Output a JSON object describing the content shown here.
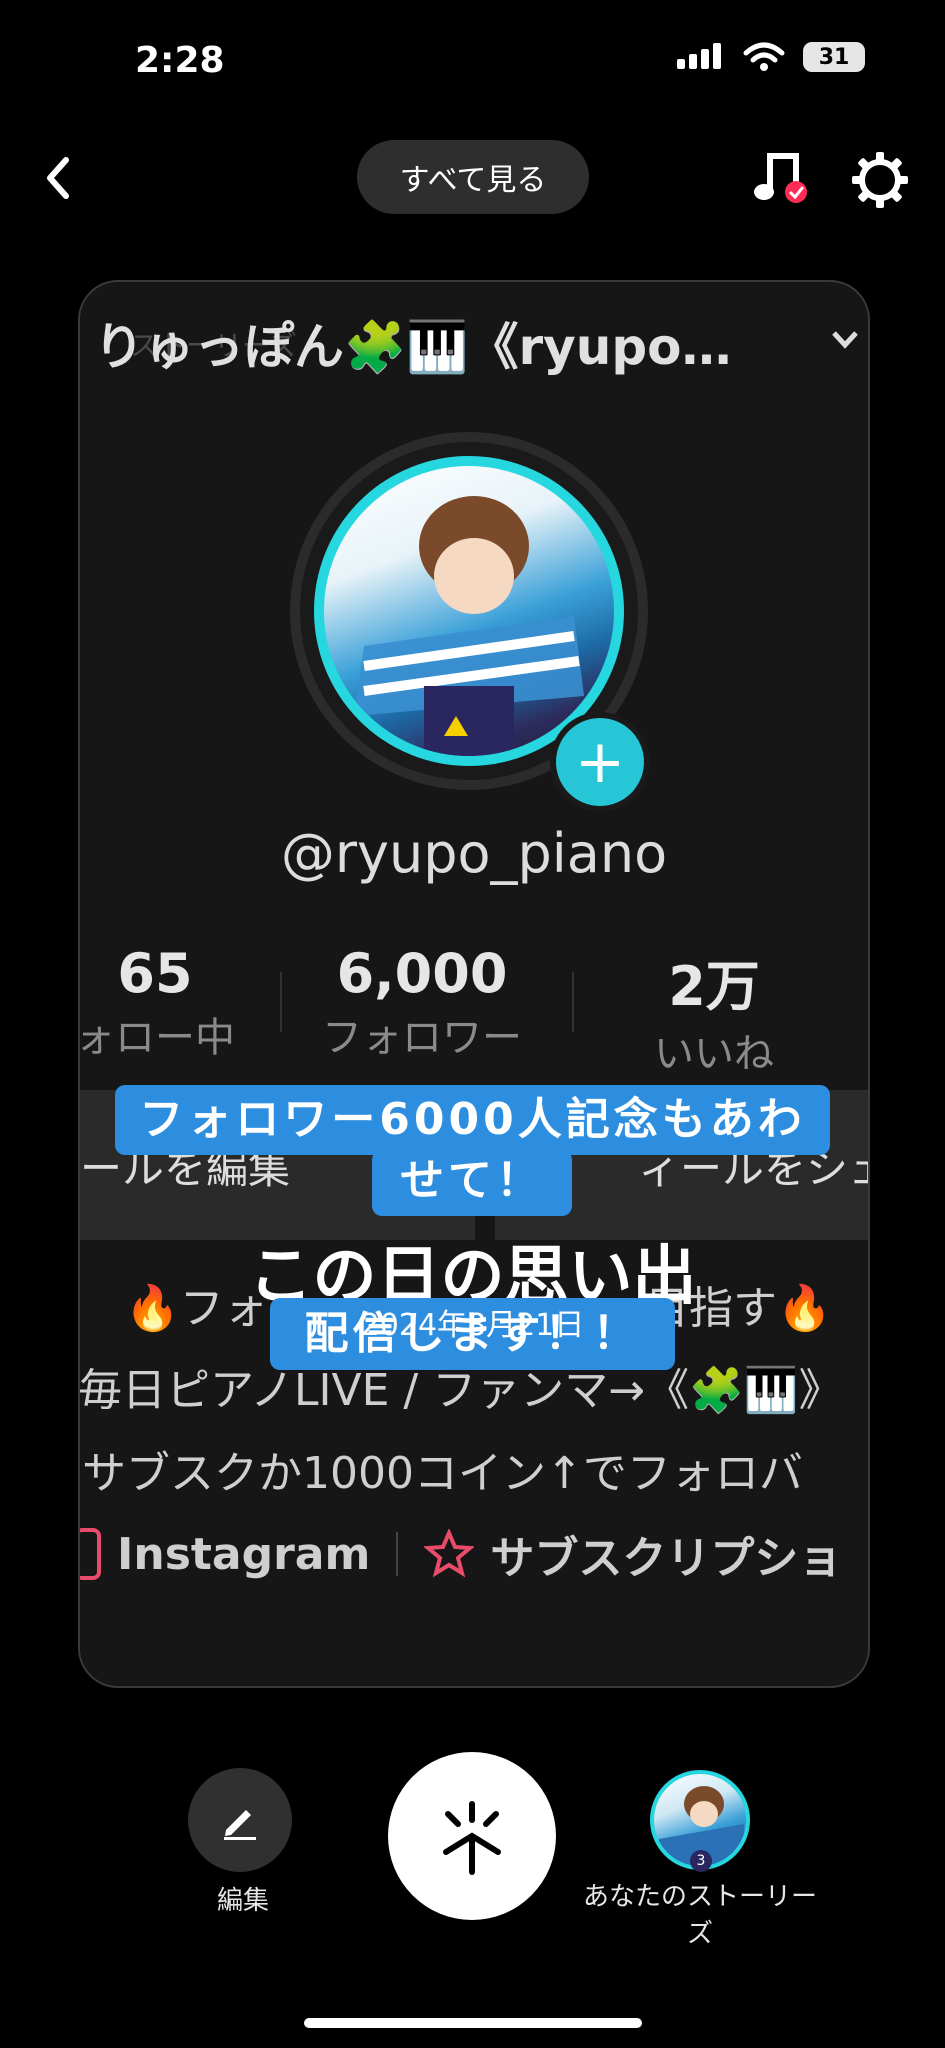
{
  "status": {
    "time": "2:28",
    "battery": "31"
  },
  "header": {
    "see_all": "すべて見る"
  },
  "card": {
    "profile_name": "りゅっぽん🧩🎹《ryupo…",
    "story_ghost": "ストーリーズ",
    "handle": "@ryupo_piano",
    "stats": [
      {
        "value": "65",
        "label": "ォロー中"
      },
      {
        "value": "6,000",
        "label": "フォロワー"
      },
      {
        "value": "2万",
        "label": "いいね"
      }
    ],
    "buttons": {
      "edit": "ールを編集",
      "share": "ィールをシェ"
    },
    "bio": [
      "🔥フォ",
      "目指す🔥",
      "毎日ピアノLIVE / ファンマ→《🧩🎹》",
      "サブスクか1000コイン↑でフォロバ"
    ],
    "links": {
      "instagram": "Instagram",
      "subscription": "サブスクリプショ"
    }
  },
  "stickers": {
    "main_line1": "フォロワー6000人記念もあわ",
    "main_line2": "せて！",
    "broadcast": "配信します！！"
  },
  "memory": {
    "title": "この日の思い出",
    "date": "2024年8月21日"
  },
  "bottom": {
    "edit_label": "編集",
    "stories_label": "あなたのストーリーズ",
    "stories_badge": "3"
  }
}
